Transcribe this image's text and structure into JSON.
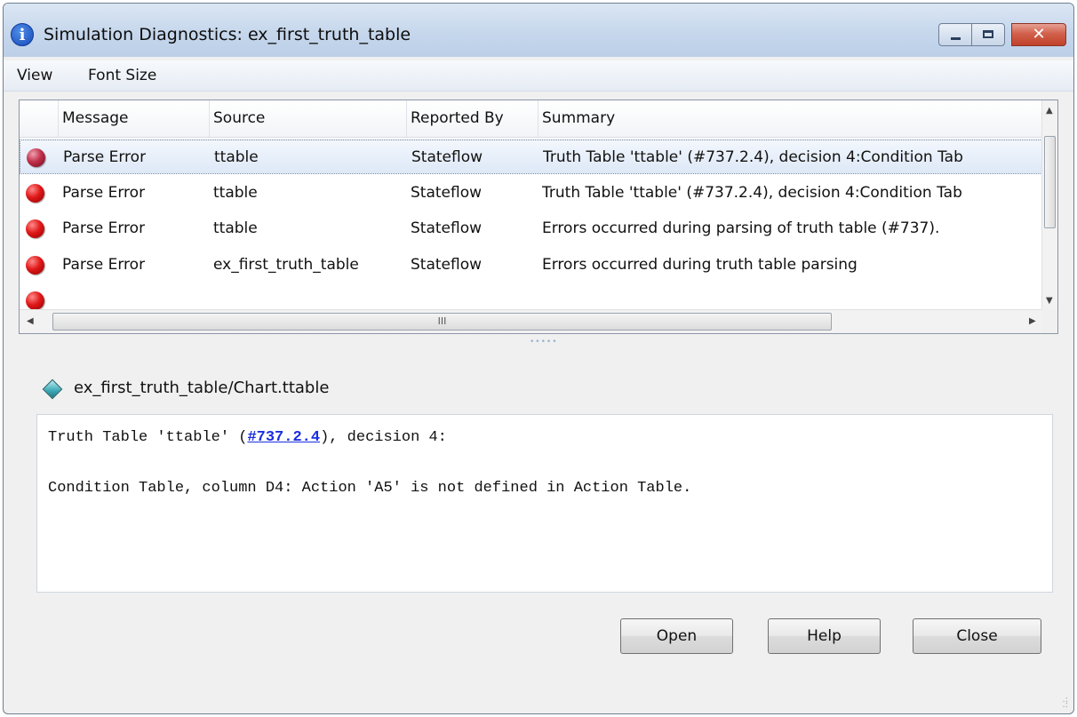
{
  "window": {
    "title": "Simulation Diagnostics: ex_first_truth_table",
    "close_glyph": "✕"
  },
  "menu": {
    "items": [
      "View",
      "Font Size"
    ]
  },
  "list": {
    "columns": [
      "Message",
      "Source",
      "Reported By",
      "Summary"
    ],
    "rows": [
      {
        "message": "Parse Error",
        "source": "ttable",
        "reported_by": "Stateflow",
        "summary": "Truth Table 'ttable' (#737.2.4), decision 4:Condition Tab",
        "selected": true
      },
      {
        "message": "Parse Error",
        "source": "ttable",
        "reported_by": "Stateflow",
        "summary": "Truth Table 'ttable' (#737.2.4), decision 4:Condition Tab",
        "selected": false
      },
      {
        "message": "Parse Error",
        "source": "ttable",
        "reported_by": "Stateflow",
        "summary": "Errors occurred during parsing of truth table (#737).",
        "selected": false
      },
      {
        "message": "Parse Error",
        "source": "ex_first_truth_table",
        "reported_by": "Stateflow",
        "summary": "Errors occurred during truth table parsing",
        "selected": false
      }
    ],
    "hscroll_grip": "III"
  },
  "detail": {
    "path": "ex_first_truth_table/Chart.ttable",
    "line1_prefix": "Truth Table 'ttable' (",
    "link": "#737.2.4",
    "line1_suffix": "), decision 4:",
    "line2": "Condition Table, column D4: Action 'A5' is not defined in Action Table."
  },
  "buttons": {
    "open": "Open",
    "help": "Help",
    "close": "Close"
  },
  "colors": {
    "error_red": "#e01818",
    "link": "#1a2ee0",
    "close_button": "#c0412a"
  }
}
